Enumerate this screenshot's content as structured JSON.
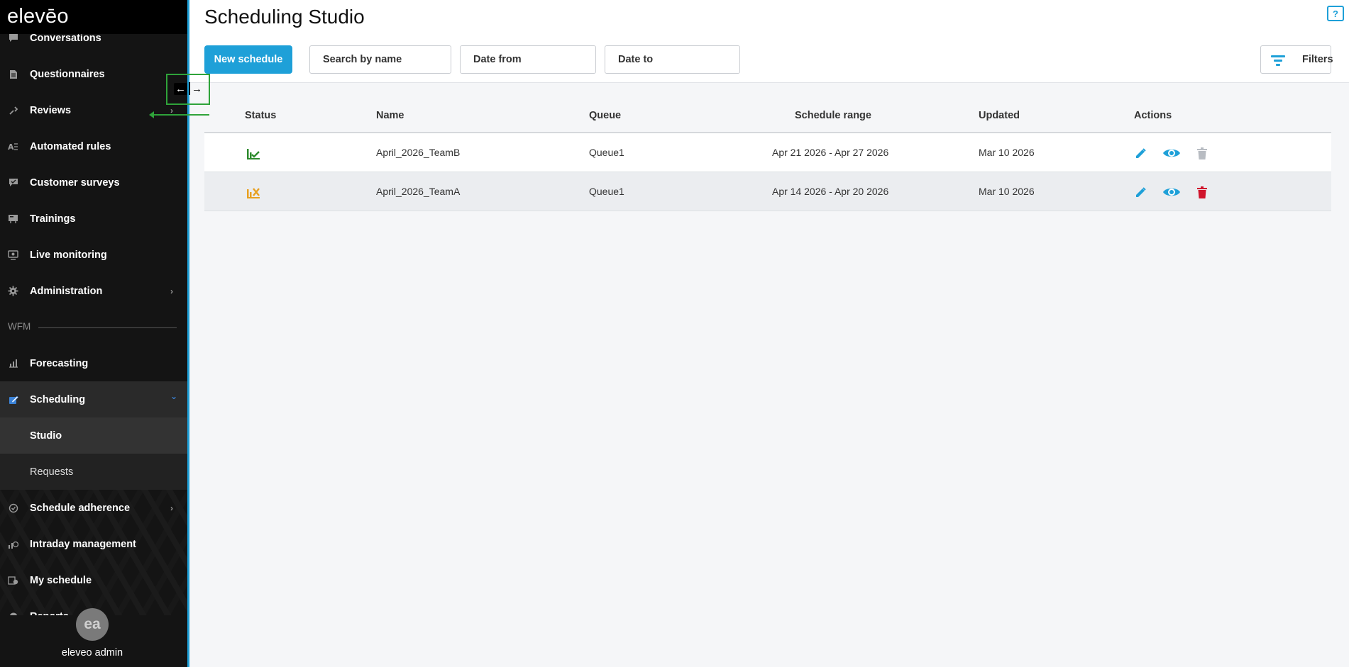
{
  "app": {
    "logo_text": "elevēo"
  },
  "sidebar": {
    "items": [
      {
        "label": "Conversations",
        "icon": "chat-icon"
      },
      {
        "label": "Questionnaires",
        "icon": "document-icon"
      },
      {
        "label": "Reviews",
        "icon": "reviews-icon",
        "chevron": "›"
      },
      {
        "label": "Automated rules",
        "icon": "rules-icon"
      },
      {
        "label": "Customer surveys",
        "icon": "survey-icon"
      },
      {
        "label": "Trainings",
        "icon": "training-icon"
      },
      {
        "label": "Live monitoring",
        "icon": "monitor-icon"
      },
      {
        "label": "Administration",
        "icon": "gear-icon",
        "chevron": "›"
      }
    ],
    "section_label": "WFM",
    "wfm_items": [
      {
        "label": "Forecasting",
        "icon": "chart-icon"
      },
      {
        "label": "Scheduling",
        "icon": "edit-icon",
        "chevron": "⌄"
      }
    ],
    "sub_items": [
      {
        "label": "Studio"
      },
      {
        "label": "Requests"
      }
    ],
    "more_items": [
      {
        "label": "Schedule adherence",
        "icon": "check-circle-icon",
        "chevron": "›"
      },
      {
        "label": "Intraday management",
        "icon": "intraday-icon"
      },
      {
        "label": "My schedule",
        "icon": "calendar-icon"
      },
      {
        "label": "Reports",
        "icon": "reports-icon",
        "chevron": "›"
      }
    ],
    "user": {
      "initials": "ea",
      "name": "eleveo admin"
    }
  },
  "header": {
    "title": "Scheduling Studio",
    "help_icon_text": "?"
  },
  "toolbar": {
    "new_schedule_label": "New schedule",
    "search_placeholder": "Search by name",
    "date_from_placeholder": "Date from",
    "date_to_placeholder": "Date to",
    "filters_label": "Filters"
  },
  "table": {
    "columns": [
      "Status",
      "Name",
      "Queue",
      "Schedule range",
      "Updated",
      "Actions"
    ],
    "rows": [
      {
        "status": "published",
        "status_color": "#2e8b2e",
        "name": "April_2026_TeamB",
        "queue": "Queue1",
        "range": "Apr 21 2026 - Apr 27 2026",
        "updated": "Mar 10 2026",
        "delete_enabled": false
      },
      {
        "status": "unpublished",
        "status_color": "#e8a020",
        "name": "April_2026_TeamA",
        "queue": "Queue1",
        "range": "Apr 14 2026 - Apr 20 2026",
        "updated": "Mar 10 2026",
        "delete_enabled": true
      }
    ]
  },
  "colors": {
    "accent": "#1ea0d8",
    "delete_active": "#d0142c",
    "delete_disabled": "#b8bcc2"
  }
}
